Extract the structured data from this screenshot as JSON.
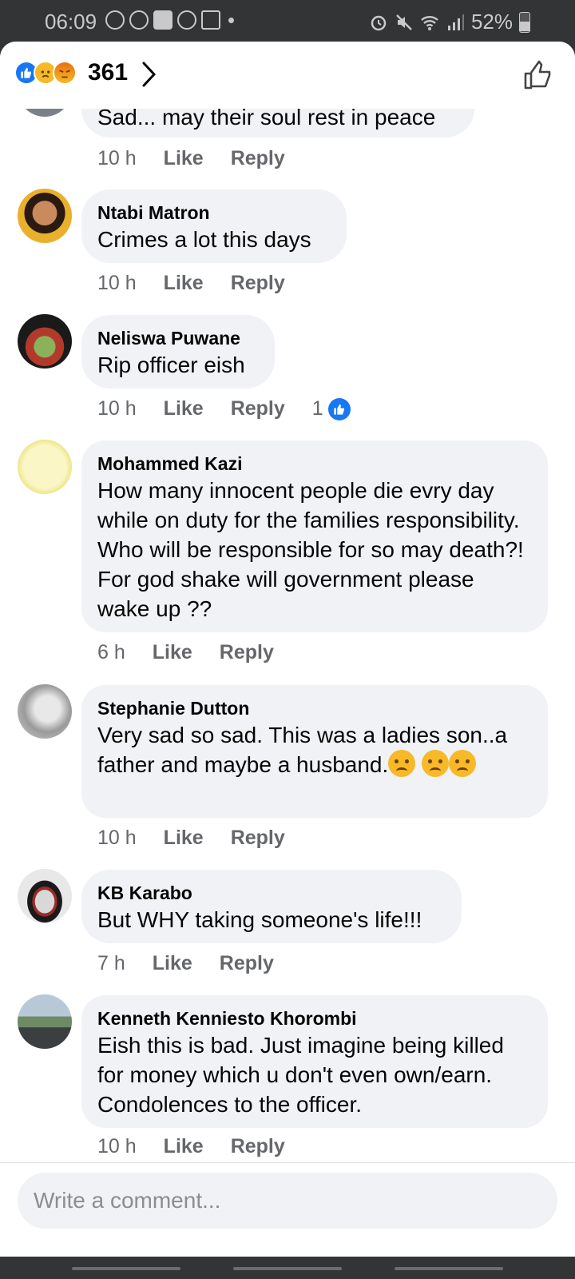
{
  "status_bar": {
    "time": "06:09",
    "battery": "52%"
  },
  "reactions": {
    "count": "361",
    "icons": [
      "like-icon",
      "sad-icon",
      "angry-icon"
    ]
  },
  "composer": {
    "placeholder": "Write a comment..."
  },
  "colors": {
    "accent": "#1877f2",
    "bubble": "#f0f2f5",
    "meta": "#65676b"
  },
  "comments": [
    {
      "name": "",
      "text": "Sad... may their soul rest in peace",
      "time": "10 h",
      "like": "Like",
      "reply": "Reply"
    },
    {
      "name": "Ntabi Matron",
      "text": "Crimes a lot this days",
      "time": "10 h",
      "like": "Like",
      "reply": "Reply"
    },
    {
      "name": "Neliswa Puwane",
      "text": "Rip officer eish",
      "time": "10 h",
      "like": "Like",
      "reply": "Reply",
      "reaction_count": "1"
    },
    {
      "name": "Mohammed Kazi",
      "text": "How many innocent people die evry day while on duty for the families responsibility. Who will be responsible for so may death?! For god shake will government please wake up ??",
      "time": "6 h",
      "like": "Like",
      "reply": "Reply"
    },
    {
      "name": "Stephanie Dutton",
      "text": "Very sad  so sad. This was a ladies son..a father and maybe a husband.",
      "time": "10 h",
      "like": "Like",
      "reply": "Reply"
    },
    {
      "name": "KB Karabo",
      "text": "But WHY taking someone's life!!!",
      "time": "7 h",
      "like": "Like",
      "reply": "Reply"
    },
    {
      "name": "Kenneth Kenniesto Khorombi",
      "text": "Eish this is bad. Just imagine being killed for money which u don't even own/earn. Condolences to the officer.",
      "time": "10 h",
      "like": "Like",
      "reply": "Reply"
    }
  ]
}
